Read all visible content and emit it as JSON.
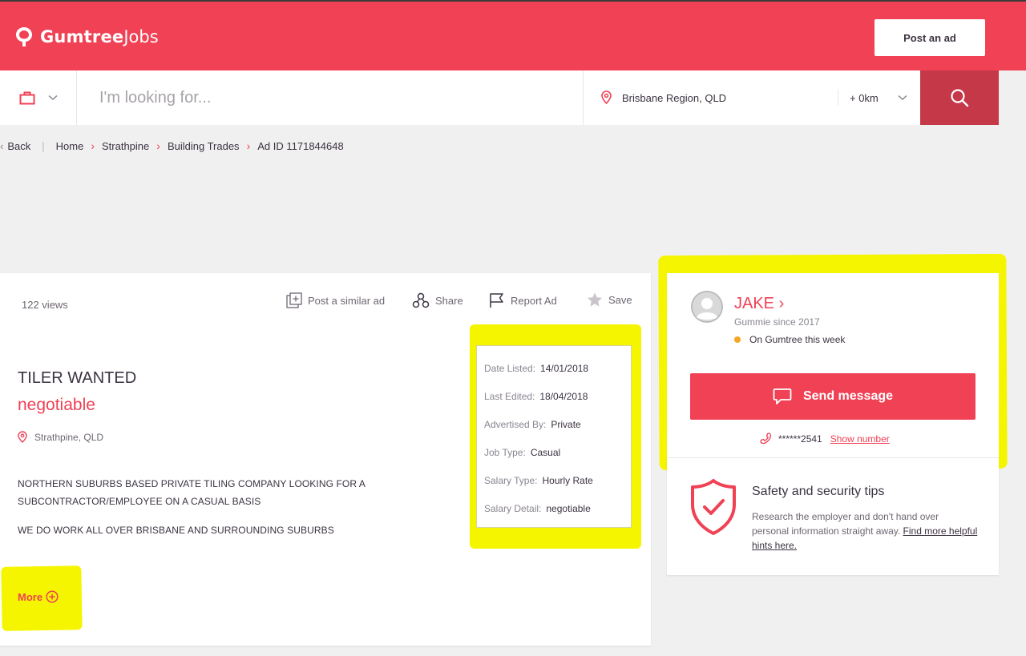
{
  "header": {
    "brand_bold": "Gumtree",
    "brand_light": "Jobs",
    "post_ad_label": "Post an ad"
  },
  "search": {
    "placeholder": "I'm looking for...",
    "location": "Brisbane Region, QLD",
    "radius": "+ 0km"
  },
  "breadcrumb": {
    "back": "Back",
    "items": [
      "Home",
      "Strathpine",
      "Building Trades",
      "Ad ID 1171844648"
    ]
  },
  "ad": {
    "views": "122  views",
    "actions": {
      "post_similar": "Post a similar ad",
      "share": "Share",
      "report": "Report Ad",
      "save": "Save"
    },
    "title": "TILER WANTED",
    "price": "negotiable",
    "location": "Strathpine, QLD",
    "description": [
      "NORTHERN SUBURBS BASED PRIVATE TILING COMPANY LOOKING FOR A",
      "SUBCONTRACTOR/EMPLOYEE ON A CASUAL BASIS",
      "WE DO WORK ALL OVER BRISBANE AND SURROUNDING SUBURBS"
    ],
    "more_label": "More",
    "details": [
      {
        "label": "Date Listed:",
        "value": "14/01/2018"
      },
      {
        "label": "Last Edited:",
        "value": "18/04/2018"
      },
      {
        "label": "Advertised By:",
        "value": "Private"
      },
      {
        "label": "Job Type:",
        "value": "Casual"
      },
      {
        "label": "Salary Type:",
        "value": "Hourly Rate"
      },
      {
        "label": "Salary Detail:",
        "value": "negotiable"
      }
    ]
  },
  "seller": {
    "name": "JAKE",
    "member_since": "Gummie since 2017",
    "status": "On Gumtree this week",
    "send_message_label": "Send message",
    "phone_masked": "******2541",
    "show_number_label": "Show number"
  },
  "safety": {
    "title": "Safety and security tips",
    "text": "Research the employer and don't hand over personal information straight away.",
    "link": "Find more helpful hints here."
  },
  "colors": {
    "brand": "#f04155",
    "search_button": "#c53848",
    "highlight": "#f5f500",
    "online_dot": "#f5a623"
  },
  "icons": {
    "logo": "gumtree-leaf-icon",
    "category": "briefcase-icon",
    "location": "map-pin-icon",
    "search": "search-icon",
    "post_similar": "add-square-icon",
    "share": "share-icon",
    "report": "flag-icon",
    "save": "star-icon",
    "more": "plus-circle-icon",
    "send": "chat-bubble-icon",
    "phone": "phone-icon",
    "safety": "shield-check-icon"
  }
}
